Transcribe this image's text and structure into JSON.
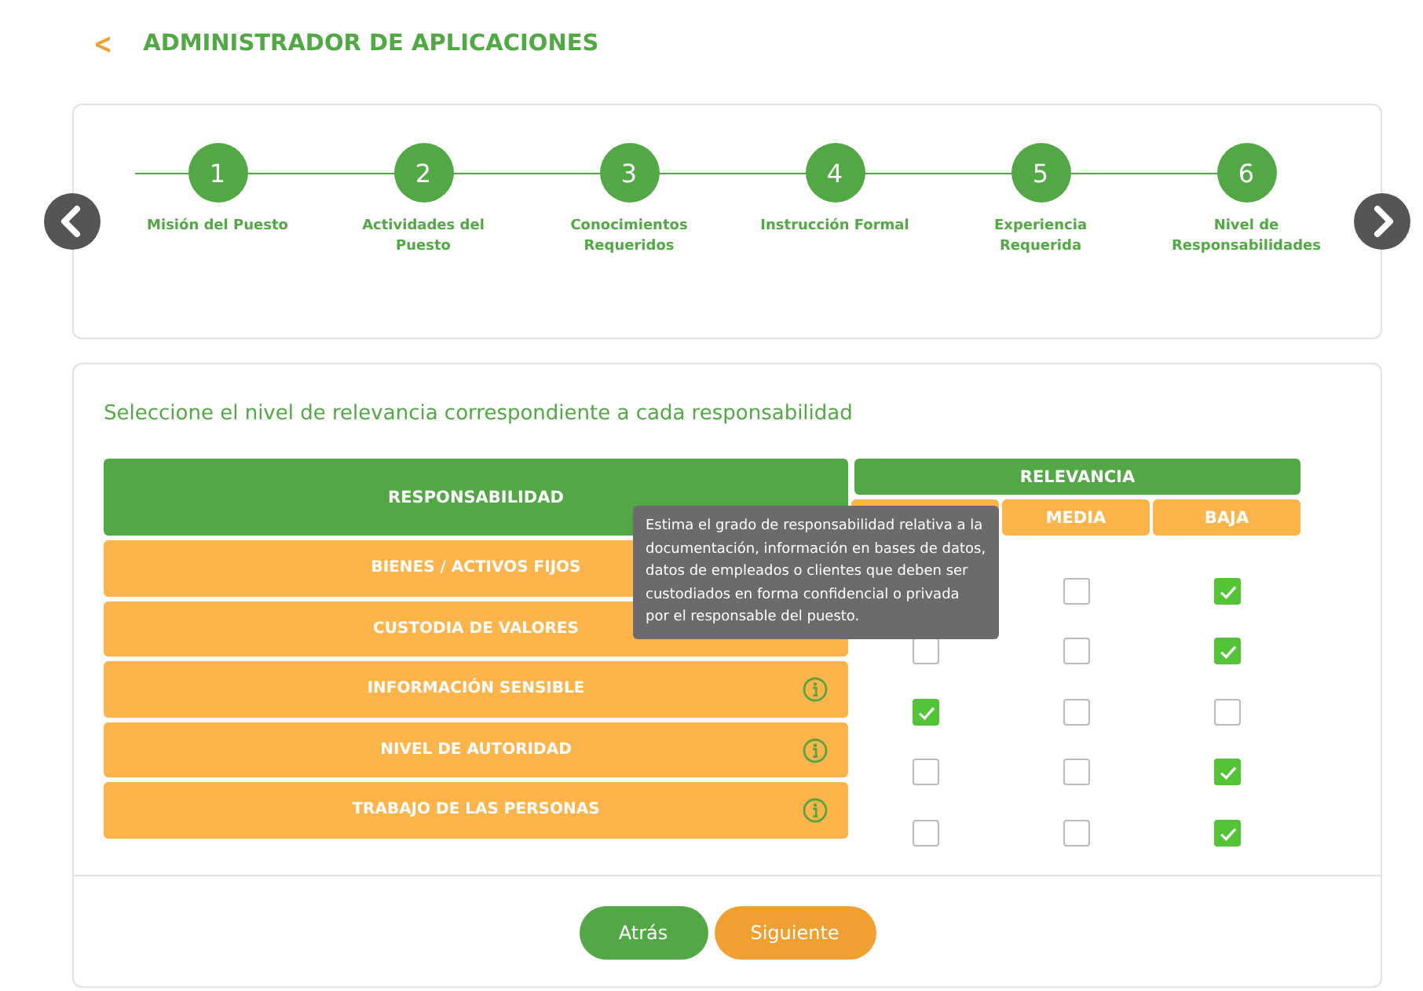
{
  "header": {
    "back": "<",
    "title": "ADMINISTRADOR DE APLICACIONES"
  },
  "steps": [
    {
      "number": "1",
      "label": "Misión del Puesto"
    },
    {
      "number": "2",
      "label": "Actividades del Puesto"
    },
    {
      "number": "3",
      "label": "Conocimientos Requeridos"
    },
    {
      "number": "4",
      "label": "Instrucción Formal"
    },
    {
      "number": "5",
      "label": "Experiencia Requerida"
    },
    {
      "number": "6",
      "label": "Nivel de Responsabilidades"
    }
  ],
  "instruction": "Seleccione el nivel de relevancia correspondiente a cada responsabilidad",
  "table": {
    "main_heading": "RESPONSABILIDAD",
    "group_heading": "RELEVANCIA",
    "columns": [
      {
        "kind": "covered"
      },
      {
        "kind": "label",
        "label": "MEDIA"
      },
      {
        "kind": "label",
        "label": "BAJA"
      }
    ],
    "rows": [
      {
        "name": "BIENES / ACTIVOS FIJOS",
        "cells": [
          {
            "kind": "covered"
          },
          {
            "kind": "box",
            "checked": false
          },
          {
            "kind": "box",
            "checked": true
          }
        ]
      },
      {
        "name": "CUSTODIA DE VALORES",
        "cells": [
          {
            "kind": "box",
            "checked": false
          },
          {
            "kind": "box",
            "checked": false
          },
          {
            "kind": "box",
            "checked": true
          }
        ]
      },
      {
        "name": "INFORMACIÓN SENSIBLE",
        "info": true,
        "cells": [
          {
            "kind": "box",
            "checked": true
          },
          {
            "kind": "box",
            "checked": false
          },
          {
            "kind": "box",
            "checked": false
          }
        ]
      },
      {
        "name": "NIVEL DE AUTORIDAD",
        "info": true,
        "cells": [
          {
            "kind": "box",
            "checked": false
          },
          {
            "kind": "box",
            "checked": false
          },
          {
            "kind": "box",
            "checked": true
          }
        ]
      },
      {
        "name": "TRABAJO DE LAS PERSONAS",
        "info": true,
        "cells": [
          {
            "kind": "box",
            "checked": false
          },
          {
            "kind": "box",
            "checked": false
          },
          {
            "kind": "box",
            "checked": true
          }
        ]
      }
    ]
  },
  "tooltip": "Estima el grado de responsabilidad relativa a la documentación, información en bases de datos, datos de empleados o clientes que deben ser custodiados en forma confidencial o privada por el responsable del puesto.",
  "buttons": [
    {
      "kind": "secondary",
      "label": "Atrás"
    },
    {
      "kind": "primary",
      "label": "Siguiente"
    }
  ]
}
